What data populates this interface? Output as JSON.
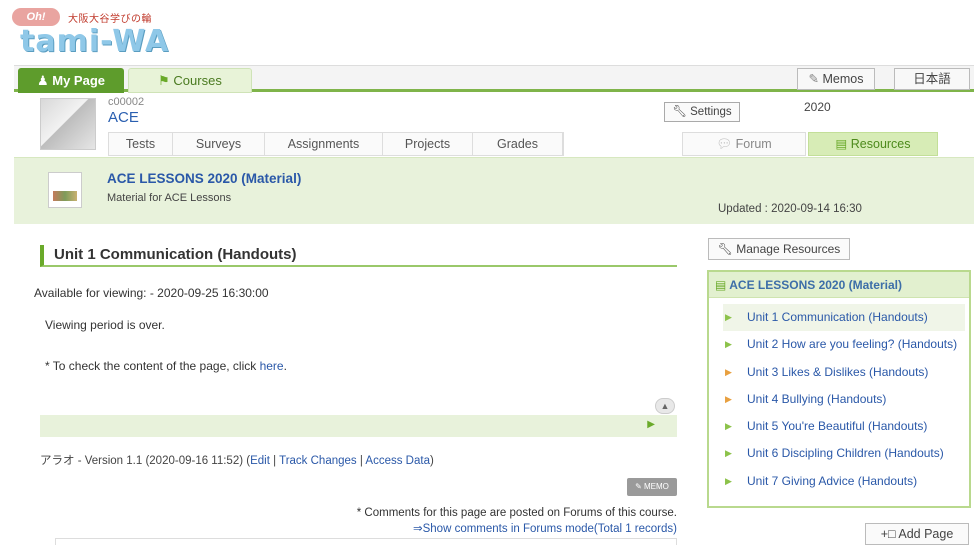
{
  "logo": {
    "badge": "Oh!",
    "subtitle": "大阪大谷学びの輪",
    "name": "tami-WA"
  },
  "topnav": {
    "my_page": "My Page",
    "courses": "Courses",
    "memos": "Memos",
    "language": "日本語"
  },
  "course": {
    "code": "c00002",
    "name": "ACE",
    "year": "2020",
    "settings": "Settings",
    "tabs": [
      "Tests",
      "Surveys",
      "Assignments",
      "Projects",
      "Grades"
    ],
    "forum": "Forum",
    "resources": "Resources"
  },
  "material": {
    "title": "ACE LESSONS 2020 (Material)",
    "description": "Material for ACE Lessons",
    "updated": "Updated :  2020-09-14 16:30"
  },
  "page": {
    "title": "Unit 1 Communication (Handouts)",
    "available": "Available for viewing: - 2020-09-25 16:30:00",
    "period_over": "Viewing period is over.",
    "check_prefix": "* To check the content of the page, click ",
    "check_link": "here",
    "check_suffix": ".",
    "version_prefix": "アラオ - Version 1.1 (2020-09-16 11:52) (",
    "edit": "Edit",
    "track_changes": "Track Changes",
    "access_data": "Access Data",
    "version_suffix": ")",
    "memo_label": "MEMO",
    "comments_note": "* Comments for this page are posted on Forums of this course.",
    "show_comments": "⇒Show comments in Forums mode(Total 1 records)"
  },
  "sidebar": {
    "manage_resources": "Manage Resources",
    "box_title": "ACE LESSONS 2020 (Material)",
    "items": [
      {
        "label": "Unit 1 Communication (Handouts)",
        "active": true
      },
      {
        "label": "Unit 2 How are you feeling? (Handouts)"
      },
      {
        "label": "Unit 3 Likes & Dislikes (Handouts)"
      },
      {
        "label": "Unit 4 Bullying (Handouts)"
      },
      {
        "label": "Unit 5 You're Beautiful (Handouts)"
      },
      {
        "label": "Unit 6 Discipling Children (Handouts)"
      },
      {
        "label": "Unit 7 Giving Advice (Handouts)"
      }
    ],
    "add_page": "Add Page"
  },
  "icons": {
    "user": "user-icon",
    "courses": "courses-icon",
    "memo": "memo-icon",
    "wrench": "wrench-icon",
    "forum": "forum-icon",
    "book": "book-icon",
    "add": "add-page-icon"
  },
  "colors": {
    "accent_green": "#5e9c2c",
    "link_blue": "#2a58a8",
    "banner_bg": "#e8f2db"
  }
}
